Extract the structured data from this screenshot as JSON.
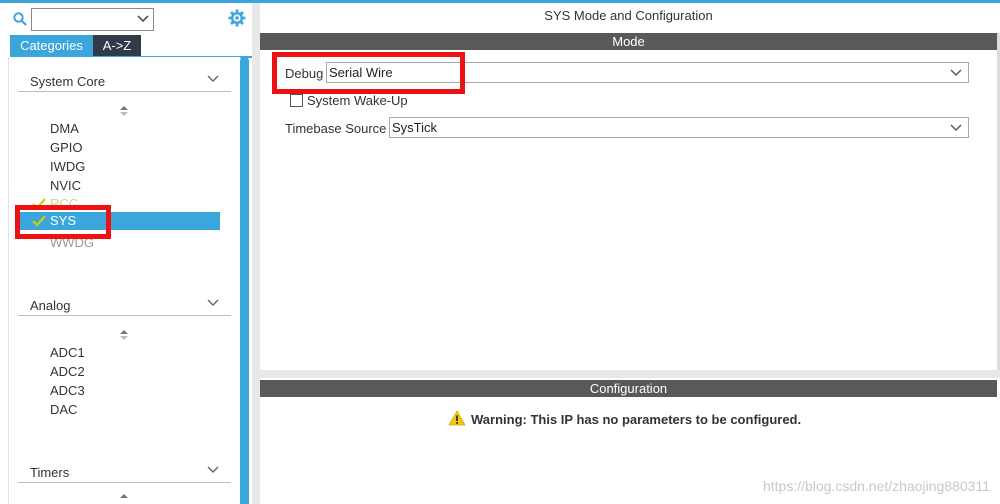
{
  "left_panel": {
    "search": {
      "value": ""
    },
    "tabs": [
      {
        "label": "Categories"
      },
      {
        "label": "A->Z"
      }
    ],
    "categories": [
      {
        "label": "System Core",
        "items": [
          "DMA",
          "GPIO",
          "IWDG",
          "NVIC",
          "RCC",
          "SYS",
          "WWDG"
        ]
      },
      {
        "label": "Analog",
        "items": [
          "ADC1",
          "ADC2",
          "ADC3",
          "DAC"
        ]
      },
      {
        "label": "Timers",
        "items": []
      }
    ]
  },
  "right_panel": {
    "title": "SYS Mode and Configuration",
    "mode_header": "Mode",
    "debug": {
      "label": "Debug",
      "value": "Serial Wire"
    },
    "wakeup": {
      "label": "System Wake-Up"
    },
    "timebase": {
      "label": "Timebase Source",
      "value": "SysTick"
    },
    "config_header": "Configuration",
    "warning": "Warning: This IP has no parameters to be configured."
  },
  "watermark": "https://blog.csdn.net/zhaojing880311",
  "colors": {
    "accent": "#3aa6dc",
    "header_bar": "#595959",
    "highlight_box": "#ef1111",
    "check": "#c8d400",
    "warning": "#f5c518"
  }
}
